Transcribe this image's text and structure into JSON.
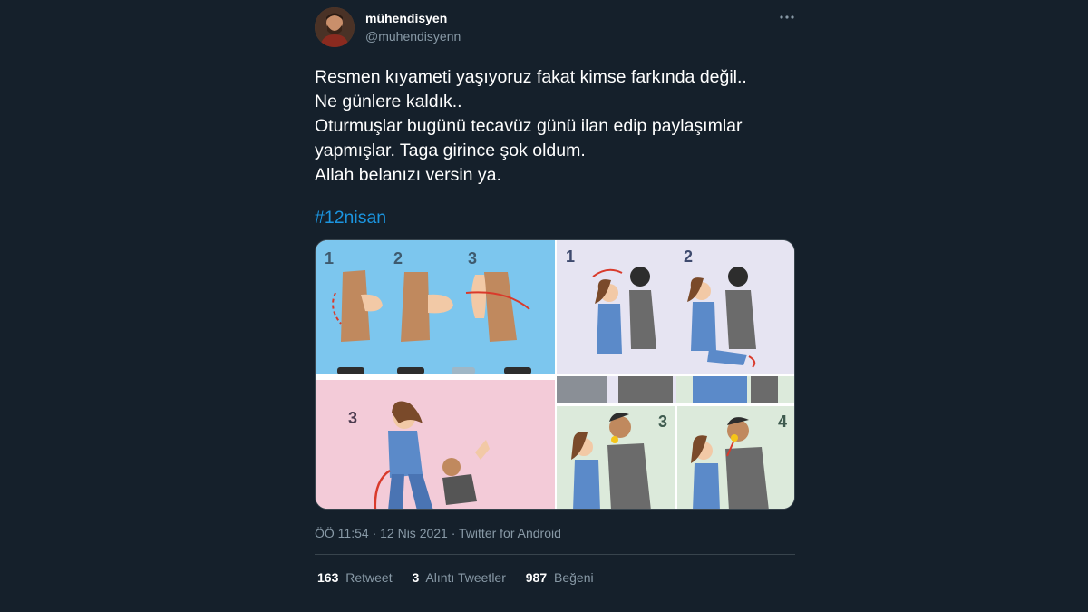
{
  "user": {
    "display_name": "mühendisyen",
    "handle": "@muhendisyenn"
  },
  "tweet": {
    "lines": [
      "Resmen kıyameti yaşıyoruz fakat kimse farkında değil..",
      "Ne günlere kaldık..",
      "Oturmuşlar bugünü tecavüz günü ilan edip paylaşımlar",
      "yapmışlar. Taga girince şok oldum.",
      "Allah belanızı versin ya."
    ],
    "hashtag": "#12nisan"
  },
  "media": {
    "panels": [
      {
        "numbers": [
          "1",
          "2",
          "3"
        ]
      },
      {
        "numbers": [
          "1",
          "2"
        ]
      },
      {
        "numbers": [
          "3"
        ]
      },
      {
        "numbers": [
          "3",
          "4"
        ]
      }
    ]
  },
  "meta": {
    "time": "ÖÖ 11:54",
    "sep1": "·",
    "date": "12 Nis 2021",
    "sep2": "·",
    "source": "Twitter for Android"
  },
  "stats": {
    "retweets": {
      "count": "163",
      "label": "Retweet"
    },
    "quotes": {
      "count": "3",
      "label": "Alıntı Tweetler"
    },
    "likes": {
      "count": "987",
      "label": "Beğeni"
    }
  },
  "colors": {
    "background": "#15202b",
    "text": "#ffffff",
    "secondary": "#8899a6",
    "link": "#1b95e0",
    "border": "#38444d"
  },
  "icons": [
    "avatar",
    "more-icon"
  ]
}
